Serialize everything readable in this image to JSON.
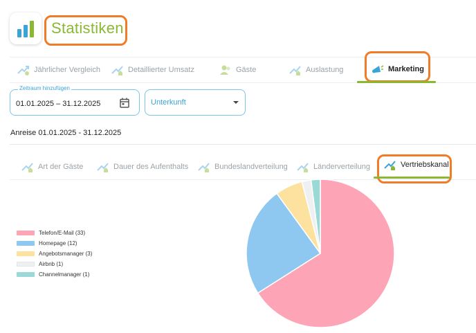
{
  "header": {
    "title": "Statistiken"
  },
  "main_tabs": [
    {
      "label": "Jährlicher Vergleich",
      "icon": "chart-trend-icon",
      "active": false
    },
    {
      "label": "Detaillierter Umsatz",
      "icon": "chart-house-icon",
      "active": false
    },
    {
      "label": "Gäste",
      "icon": "guests-icon",
      "active": false
    },
    {
      "label": "Auslastung",
      "icon": "chart-house-icon",
      "active": false
    },
    {
      "label": "Marketing",
      "icon": "megaphone-icon",
      "active": true
    }
  ],
  "filters": {
    "date_range_legend": "Zeitraum hinzufügen",
    "date_range_value": "01.01.2025 – 31.12.2025",
    "accommodation_placeholder": "Unterkunft"
  },
  "arrival_text": "Anreise 01.01.2025 - 31.12.2025",
  "sub_tabs": [
    {
      "label": "Art der Gäste",
      "active": false
    },
    {
      "label": "Dauer des Aufenthalts",
      "active": false
    },
    {
      "label": "Bundeslandverteilung",
      "active": false
    },
    {
      "label": "Länderverteilung",
      "active": false
    },
    {
      "label": "Vertriebskanal",
      "active": true
    }
  ],
  "colors": {
    "accent_green": "#8bb832",
    "highlight_orange": "#f07c2a",
    "input_blue": "#3aa3d8"
  },
  "chart_data": {
    "type": "pie",
    "legend_position": "left",
    "series": [
      {
        "name": "Telefon/E-Mail",
        "value": 33,
        "label": "Telefon/E-Mail (33)",
        "color": "#fda4b6"
      },
      {
        "name": "Homepage",
        "value": 12,
        "label": "Homepage (12)",
        "color": "#8ec8f0"
      },
      {
        "name": "Angebotsmanager",
        "value": 3,
        "label": "Angebotsmanager (3)",
        "color": "#fde29f"
      },
      {
        "name": "Airbnb",
        "value": 1,
        "label": "Airbnb (1)",
        "color": "#eef0f2"
      },
      {
        "name": "Channelmanager",
        "value": 1,
        "label": "Channelmanager (1)",
        "color": "#9ad9d6"
      }
    ]
  }
}
